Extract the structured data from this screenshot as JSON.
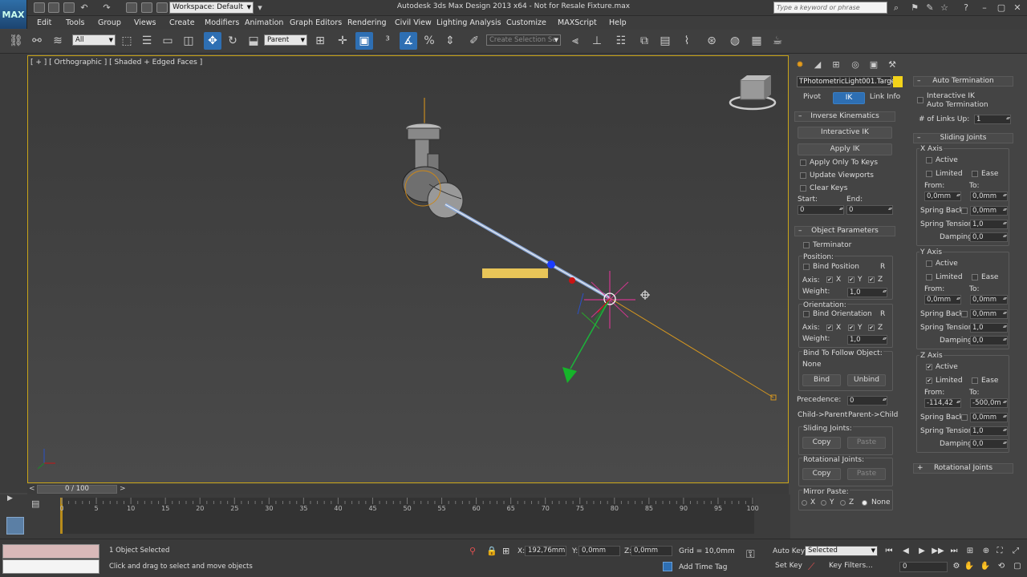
{
  "title_bar": {
    "app_title": "Autodesk 3ds Max Design 2013 x64    -  Not for Resale    Fixture.max",
    "logo_text": "MAX",
    "workspace": "Workspace: Default",
    "search_placeholder": "Type a keyword or phrase"
  },
  "menu": [
    "Edit",
    "Tools",
    "Group",
    "Views",
    "Create",
    "Modifiers",
    "Animation",
    "Graph Editors",
    "Rendering",
    "Civil View",
    "Lighting Analysis",
    "Customize",
    "MAXScript",
    "Help"
  ],
  "toolbar": {
    "selection_filter": "All",
    "ref_coord": "Parent",
    "named_selection": "Create Selection Se"
  },
  "viewport": {
    "label": "[ + ] [ Orthographic ] [ Shaded + Edged Faces ]"
  },
  "command_panel": {
    "object_name": "TPhotometricLight001.Target",
    "swatch_color": "#f3d31a",
    "tabs": [
      "Pivot",
      "IK",
      "Link Info"
    ],
    "ik_rollout": {
      "title": "Inverse Kinematics",
      "interactive_ik": "Interactive IK",
      "apply_ik": "Apply IK",
      "apply_only_to_keys": "Apply Only To Keys",
      "update_viewports": "Update Viewports",
      "clear_keys": "Clear Keys",
      "start_label": "Start:",
      "end_label": "End:",
      "start_value": "0",
      "end_value": "0"
    },
    "object_params": {
      "title": "Object Parameters",
      "terminator": "Terminator",
      "position_label": "Position:",
      "bind_position": "Bind Position",
      "r": "R",
      "axis_label": "Axis:",
      "x": "X",
      "y": "Y",
      "z": "Z",
      "weight_label": "Weight:",
      "weight_value": "1,0",
      "orientation_label": "Orientation:",
      "bind_orientation": "Bind Orientation",
      "weight2_value": "1,0",
      "bind_follow_label": "Bind To Follow Object:",
      "bind_follow_value": "None",
      "bind": "Bind",
      "unbind": "Unbind",
      "precedence_label": "Precedence:",
      "precedence_value": "0",
      "child_parent": "Child->Parent",
      "parent_child": "Parent->Child",
      "sliding_joints_label": "Sliding Joints:",
      "rotational_joints_label": "Rotational Joints:",
      "copy": "Copy",
      "paste": "Paste",
      "mirror_paste_label": "Mirror Paste:",
      "none": "None"
    },
    "auto_termination": {
      "title": "Auto Termination",
      "interactive_ik_auto": "Interactive IK",
      "interactive_ik_auto2": "Auto Termination",
      "links_up_label": "# of Links Up:",
      "links_up_value": "1"
    },
    "sliding_joints": {
      "title": "Sliding Joints",
      "x_axis": "X Axis",
      "y_axis": "Y Axis",
      "z_axis": "Z Axis",
      "active": "Active",
      "limited": "Limited",
      "ease": "Ease",
      "from": "From:",
      "to": "To:",
      "spring_back": "Spring Back",
      "spring_tension": "Spring Tension:",
      "damping": "Damping:",
      "zero_mm": "0,0mm",
      "one": "1,0",
      "zero": "0,0",
      "z_from": "-114,42",
      "z_to": "-500,0m"
    },
    "rotational_joints_title": "Rotational Joints"
  },
  "timeline": {
    "frame": "0 / 100",
    "ticks": [
      "0",
      "5",
      "10",
      "15",
      "20",
      "25",
      "30",
      "35",
      "40",
      "45",
      "50",
      "55",
      "60",
      "65",
      "70",
      "75",
      "80",
      "85",
      "90",
      "95",
      "100"
    ]
  },
  "status": {
    "selected": "1 Object Selected",
    "prompt": "Click and drag to select and move objects",
    "x_label": "X:",
    "x_value": "192,76mm",
    "y_label": "Y:",
    "y_value": "0,0mm",
    "z_label": "Z:",
    "z_value": "0,0mm",
    "grid": "Grid = 10,0mm",
    "add_time_tag": "Add Time Tag",
    "auto_key": "Auto Key",
    "set_key": "Set Key",
    "key_mode": "Selected",
    "key_filters": "Key Filters...",
    "current_frame": "0"
  }
}
